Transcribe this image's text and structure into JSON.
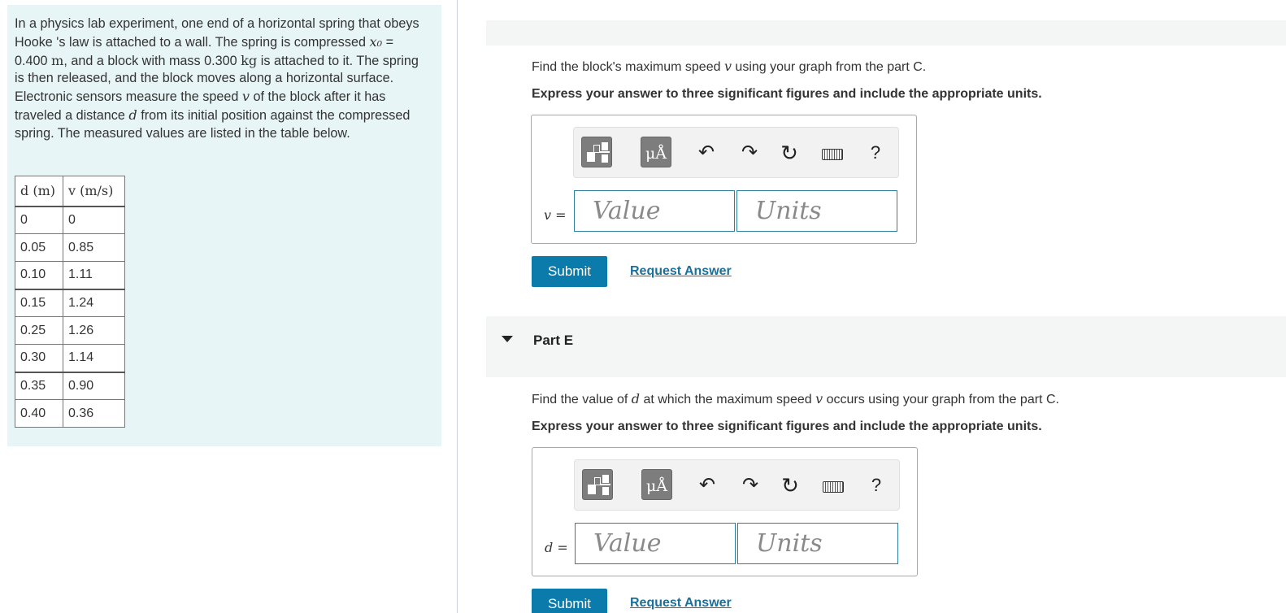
{
  "problem": {
    "text_before_x0": "In a physics lab experiment, one end of a horizontal spring that obeys Hooke 's law is attached to a wall. The spring is compressed ",
    "x0_symbol": "x₀",
    "x0_equals": " = 0.400 ",
    "x0_unit": "m",
    "mass_text": ", and a block with mass 0.300 ",
    "mass_unit": "kg",
    "mass_after": " is attached to it. The spring is then released, and the block moves along a horizontal surface. Electronic sensors measure the speed ",
    "v_symbol": "v",
    "speed_after": " of the block after it has traveled a distance ",
    "d_symbol": "d",
    "text_end": " from its initial position against the compressed spring. The measured values are listed in the table below."
  },
  "table": {
    "headers": [
      "d (m)",
      "v (m/s)"
    ],
    "rows": [
      [
        "0",
        "0"
      ],
      [
        "0.05",
        "0.85"
      ],
      [
        "0.10",
        "1.11"
      ],
      [
        "0.15",
        "1.24"
      ],
      [
        "0.25",
        "1.26"
      ],
      [
        "0.30",
        "1.14"
      ],
      [
        "0.35",
        "0.90"
      ],
      [
        "0.40",
        "0.36"
      ]
    ]
  },
  "part_d": {
    "question_pre": "Find the block's maximum speed ",
    "question_var": "v",
    "question_post": " using your graph from the part C.",
    "instruction": "Express your answer to three significant figures and include the appropriate units.",
    "eq_var": "v",
    "eq_sign": " =",
    "value_placeholder": "Value",
    "units_placeholder": "Units",
    "submit_label": "Submit",
    "request_label": "Request Answer"
  },
  "part_e": {
    "title": "Part E",
    "question_pre": "Find the value of ",
    "question_var": "d",
    "question_mid": " at which the maximum speed ",
    "question_var2": "v",
    "question_post": " occurs using your graph from the part C.",
    "instruction": "Express your answer to three significant figures and include the appropriate units.",
    "eq_var": "d",
    "eq_sign": " =",
    "value_placeholder": "Value",
    "units_placeholder": "Units",
    "submit_label": "Submit",
    "request_label": "Request Answer"
  },
  "toolbar": {
    "units_button_label": "μÅ",
    "undo_glyph": "↶",
    "redo_glyph": "↷",
    "reset_glyph": "↻",
    "help_glyph": "?",
    "icons": [
      "templates-icon",
      "units-icon",
      "undo-icon",
      "redo-icon",
      "reset-icon",
      "keyboard-icon",
      "help-icon"
    ]
  },
  "colors": {
    "panel_bg": "#e8f5f6",
    "accent": "#0b7bab",
    "link": "#1b6f98"
  }
}
